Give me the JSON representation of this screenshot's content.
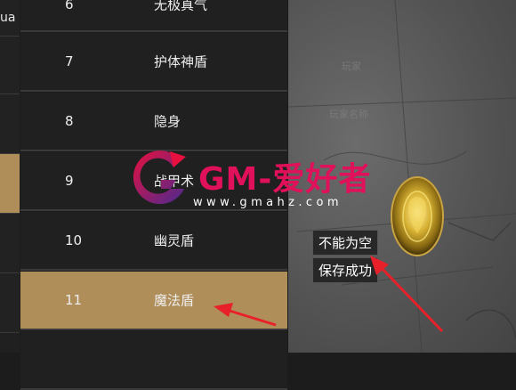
{
  "left_panel": {
    "fragment_text": "ua"
  },
  "skill_list": {
    "rows": [
      {
        "number": "6",
        "name": "无极真气",
        "selected": false
      },
      {
        "number": "7",
        "name": "护体神盾",
        "selected": false
      },
      {
        "number": "8",
        "name": "隐身",
        "selected": false
      },
      {
        "number": "9",
        "name": "战甲术",
        "selected": false
      },
      {
        "number": "10",
        "name": "幽灵盾",
        "selected": false
      },
      {
        "number": "11",
        "name": "魔法盾",
        "selected": true
      }
    ]
  },
  "game_area": {
    "messages": {
      "cannot_be_empty": "不能为空",
      "save_success": "保存成功"
    },
    "faint_labels": [
      "玩家",
      "玩家名称"
    ]
  },
  "watermark": {
    "title": "GM-爱好者",
    "url": "www.gmahz.com"
  },
  "colors": {
    "selected_row": "#b08e5a",
    "row_bg": "#202020",
    "row_border": "#3a3a3a",
    "arrow": "#e8202a",
    "watermark_pink": "#e0105a",
    "watermark_purple": "#5b2a8c"
  },
  "icons": [
    "arrow-pointer-icon",
    "golden-orb-icon",
    "gm-logo-icon"
  ]
}
